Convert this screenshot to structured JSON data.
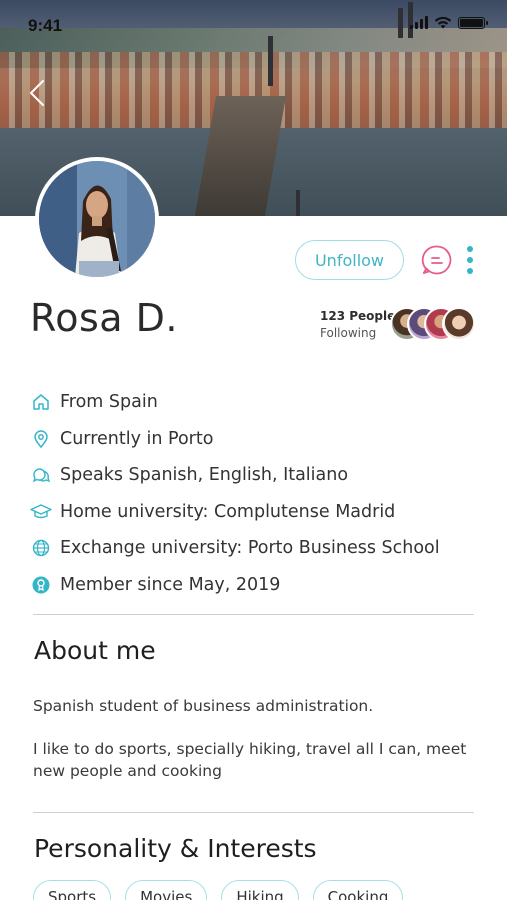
{
  "status_bar": {
    "time": "9:41"
  },
  "profile": {
    "name": "Rosa D.",
    "following": {
      "count": "123 People",
      "label": "Following"
    },
    "actions": {
      "unfollow_label": "Unfollow"
    }
  },
  "info_items": [
    {
      "icon": "home-icon",
      "text": "From Spain"
    },
    {
      "icon": "location-pin-icon",
      "text": "Currently in Porto"
    },
    {
      "icon": "speech-bubbles-icon",
      "text": "Speaks Spanish, English, Italiano"
    },
    {
      "icon": "graduation-cap-icon",
      "text": "Home university: Complutense Madrid"
    },
    {
      "icon": "globe-icon",
      "text": "Exchange university: Porto Business School"
    },
    {
      "icon": "member-badge-icon",
      "text": "Member since May, 2019"
    }
  ],
  "about": {
    "title": "About me",
    "paragraphs": [
      "Spanish student of business administration.",
      "I like to do sports, specially hiking, travel all I can, meet new people and cooking"
    ]
  },
  "interests": {
    "title": "Personality & Interests",
    "tags": [
      "Sports",
      "Movies",
      "Hiking",
      "Cooking"
    ]
  },
  "colors": {
    "accent": "#35b6c8",
    "accent_light": "#a7dfe8",
    "chat_pink": "#e85a8a"
  }
}
